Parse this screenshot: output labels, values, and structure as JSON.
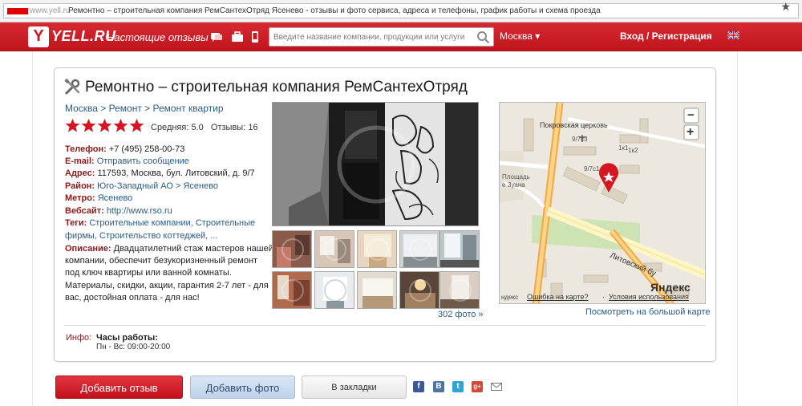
{
  "browser": {
    "url": "www.yell.ru",
    "tab_title": "Ремонтно – строительная компания РемСантехОтряд Ясенево - отзывы и фото сервиса, адреса и телефоны, график работы и схема проезда"
  },
  "header": {
    "logo_letter": "Y",
    "logo_text": "YELL.RU",
    "tagline": "Настоящие отзывы",
    "search_placeholder": "Введите название компании, продукции или услуги",
    "city": "Москва ▾",
    "login": "Вход / Регистрация",
    "icons": [
      "chat-icon",
      "briefcase-icon",
      "mobile-icon",
      "search-icon",
      "uk-flag-icon"
    ]
  },
  "company": {
    "title": "Ремонтно – строительная компания РемСантехОтряд",
    "breadcrumb": "Москва > Ремонт > Ремонт квартир",
    "rating_stars": 5,
    "rating_text": "Средняя: 5.0   Отзывы: 16",
    "phone_label": "Телефон:",
    "phone": "+7 (495) 258-00-73",
    "email_label": "E-mail:",
    "email": "Отправить сообщение",
    "address_label": "Адрес:",
    "address": "117593, Москва, бул. Литовский, д. 9/7",
    "district_label": "Район:",
    "district": "Юго-Западный АО > Ясенево",
    "metro_label": "Метро:",
    "metro": "Ясенево",
    "website_label": "Вебсайт:",
    "website": "http://www.rso.ru",
    "tags_label": "Теги:",
    "tags_line1": "Строительные компании, Строительные",
    "tags_line2": "фирмы, Строительство коттеджей, ...",
    "desc_label": "Описание:",
    "desc_line1": "Двадцатилетний стаж мастеров нашей",
    "desc_line2": "компании, обеспечит безукоризненный ремонт",
    "desc_line3": "под ключ квартиры или ванной комнаты.",
    "desc_line4": "Материалы, скидки, акции, гарантия 2-7 лет - для",
    "desc_line5": "вас, достойная оплата - для нас!"
  },
  "photos": {
    "count_link": "302 фото »"
  },
  "map": {
    "label_church": "Покровская церковь",
    "label_97c3": "9/7с3",
    "label_1k1": "1к1",
    "label_1k2": "1к2",
    "label_97c1": "9/7с1",
    "label_square": "Площадь",
    "label_square2": "е Зуана",
    "label_street": "Литовский бу",
    "label_yandex": "Яндекс",
    "label_ndex": "ндекс",
    "report_error": "Ошибка на карте?",
    "terms": "Условия использования",
    "big_map_link": "Посмотреть на большой карте",
    "zoom_in": "+",
    "zoom_out": "−"
  },
  "info": {
    "label": "Инфо:",
    "hours_title": "Часы работы:",
    "hours": "Пн - Вс: 09:00-20:00"
  },
  "actions": {
    "add_review": "Добавить отзыв",
    "add_photo": "Добавить фото",
    "bookmarks": "В закладки"
  },
  "social": {
    "facebook": "f",
    "vkontakte": "B",
    "twitter": "t",
    "googleplus": "g+"
  },
  "colors": {
    "brand_red": "#c8161f",
    "link_blue": "#2a5b86",
    "label_red": "#8b1a1a",
    "star_red": "#d5151f"
  }
}
